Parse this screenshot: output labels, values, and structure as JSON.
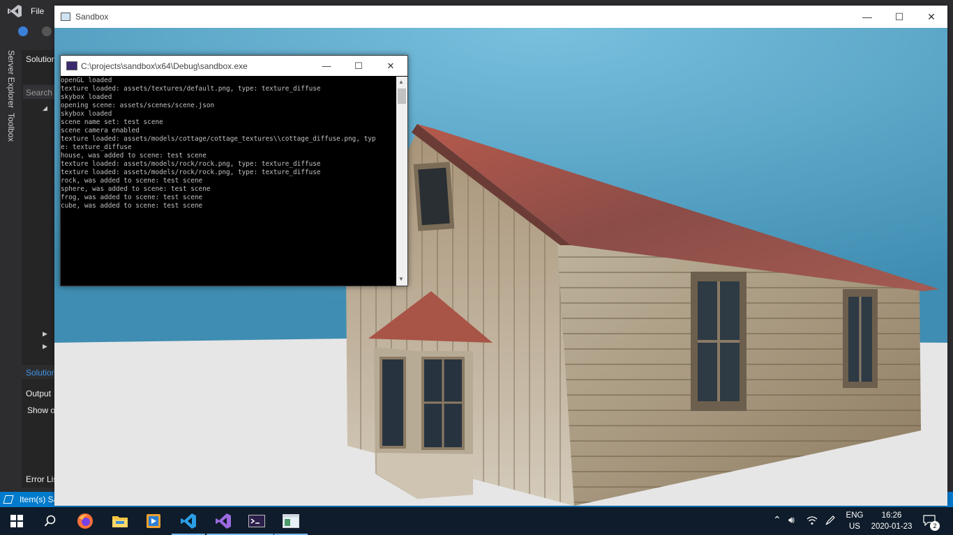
{
  "vs": {
    "menu_file": "File",
    "side_tabs": [
      "Server Explorer",
      "Toolbox"
    ],
    "solution_title": "Solution",
    "search_placeholder": "Search S",
    "solution_tab": "Solution",
    "output_title": "Output",
    "output_show": "Show o",
    "error_list": "Error Lis",
    "status_text": "Item(s) Sa",
    "colors": {
      "accent": "#007acc",
      "background": "#2d2d30"
    }
  },
  "sandbox": {
    "title": "Sandbox",
    "controls": {
      "minimize": "—",
      "maximize": "☐",
      "close": "✕"
    },
    "scene": {
      "sky_color": "#5aa9cc",
      "ground_color": "#e6e6e6"
    }
  },
  "console": {
    "title": "C:\\projects\\sandbox\\x64\\Debug\\sandbox.exe",
    "controls": {
      "minimize": "—",
      "maximize": "☐",
      "close": "✕"
    },
    "lines": [
      "openGL loaded",
      "texture loaded: assets/textures/default.png, type: texture_diffuse",
      "skybox loaded",
      "opening scene: assets/scenes/scene.json",
      "skybox loaded",
      "scene name set: test scene",
      "scene camera enabled",
      "texture loaded: assets/models/cottage/cottage_textures\\\\cottage_diffuse.png, typ",
      "e: texture_diffuse",
      "house, was added to scene: test scene",
      "texture loaded: assets/models/rock/rock.png, type: texture_diffuse",
      "texture loaded: assets/models/rock/rock.png, type: texture_diffuse",
      "rock, was added to scene: test scene",
      "sphere, was added to scene: test scene",
      "frog, was added to scene: test scene",
      "cube, was added to scene: test scene"
    ]
  },
  "taskbar": {
    "items": [
      {
        "name": "start-button",
        "icon": "windows-logo-icon"
      },
      {
        "name": "search-button",
        "icon": "search-icon"
      },
      {
        "name": "firefox",
        "icon": "firefox-icon"
      },
      {
        "name": "file-explorer",
        "icon": "folder-icon"
      },
      {
        "name": "media-player",
        "icon": "media-player-icon"
      },
      {
        "name": "vs-code",
        "icon": "vscode-icon"
      },
      {
        "name": "visual-studio",
        "icon": "visual-studio-icon"
      },
      {
        "name": "console",
        "icon": "console-icon"
      },
      {
        "name": "sandbox",
        "icon": "sandbox-window-icon"
      }
    ],
    "lang_top": "ENG",
    "lang_bottom": "US",
    "time": "16:26",
    "date": "2020-01-23",
    "notifications": "2"
  }
}
